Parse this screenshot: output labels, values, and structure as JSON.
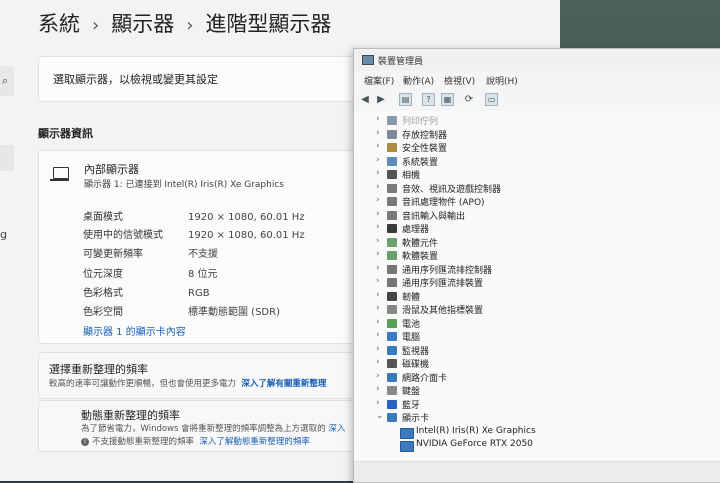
{
  "settings": {
    "breadcrumb": [
      "系統",
      "顯示器",
      "進階型顯示器"
    ],
    "select_display_label": "選取顯示器，以檢視或變更其設定",
    "display_info_title": "顯示器資訊",
    "monitor_name": "內部顯示器",
    "monitor_sub": "顯示器 1: 已連接到 Intel(R) Iris(R) Xe Graphics",
    "rows": [
      {
        "key": "桌面模式",
        "value": "1920 × 1080, 60.01 Hz"
      },
      {
        "key": "使用中的信號模式",
        "value": "1920 × 1080, 60.01 Hz"
      },
      {
        "key": "可變更新頻率",
        "value": "不支援"
      },
      {
        "key": "位元深度",
        "value": "8 位元"
      },
      {
        "key": "色彩格式",
        "value": "RGB"
      },
      {
        "key": "色彩空間",
        "value": "標準動態範圍 (SDR)"
      }
    ],
    "adapter_props_link": "顯示器 1 的顯示卡內容",
    "refresh_title": "選擇重新整理的頻率",
    "refresh_sub": "較高的速率可讓動作更順暢，但也會使用更多電力",
    "refresh_link": "深入了解有關重新整理",
    "dynamic_title": "動態重新整理的頻率",
    "dynamic_sub": "為了節省電力，Windows 會將重新整理的頻率調整為上方選取的",
    "dynamic_link_cut": "深入",
    "dynamic_note": "不支援動態重新整理的頻率",
    "dynamic_note_link": "深入了解動態重新整理的頻率",
    "side_fragment_char": "g"
  },
  "devmgr": {
    "title": "裝置管理員",
    "menu": [
      "檔案(F)",
      "動作(A)",
      "檢視(V)",
      "說明(H)"
    ],
    "toolbar_icons": [
      "back-arrow-icon",
      "forward-arrow-icon",
      "properties-icon",
      "help-icon",
      "update-driver-icon",
      "scan-hardware-icon",
      "monitor-icon"
    ],
    "tree": [
      {
        "label": "列印佇列",
        "faded": true,
        "color": "#8a9aa8"
      },
      {
        "label": "存放控制器",
        "color": "#7f8c99"
      },
      {
        "label": "安全性裝置",
        "color": "#b08a3c"
      },
      {
        "label": "系統裝置",
        "color": "#5a8cc0"
      },
      {
        "label": "相機",
        "color": "#555555"
      },
      {
        "label": "音效、視訊及遊戲控制器",
        "color": "#7a7a7a"
      },
      {
        "label": "音訊處理物件 (APO)",
        "color": "#7a7a7a"
      },
      {
        "label": "音訊輸入與輸出",
        "color": "#7a7a7a"
      },
      {
        "label": "處理器",
        "color": "#3b3b3b"
      },
      {
        "label": "軟體元件",
        "color": "#6aa06a"
      },
      {
        "label": "軟體裝置",
        "color": "#6aa06a"
      },
      {
        "label": "通用序列匯流排控制器",
        "color": "#777777"
      },
      {
        "label": "通用序列匯流排裝置",
        "color": "#777777"
      },
      {
        "label": "韌體",
        "color": "#444444"
      },
      {
        "label": "滑鼠及其他指標裝置",
        "color": "#888888"
      },
      {
        "label": "電池",
        "color": "#5aa05a"
      },
      {
        "label": "電腦",
        "color": "#3a7bbf"
      },
      {
        "label": "監視器",
        "color": "#3a7bbf"
      },
      {
        "label": "磁碟機",
        "color": "#555555"
      },
      {
        "label": "網路介面卡",
        "color": "#3a7bbf"
      },
      {
        "label": "鍵盤",
        "color": "#888888"
      },
      {
        "label": "藍牙",
        "color": "#2a63c2"
      },
      {
        "label": "顯示卡",
        "color": "#3a7bbf",
        "expanded": true
      }
    ],
    "children": [
      "Intel(R) Iris(R) Xe Graphics",
      "NVIDIA GeForce RTX 2050"
    ]
  }
}
